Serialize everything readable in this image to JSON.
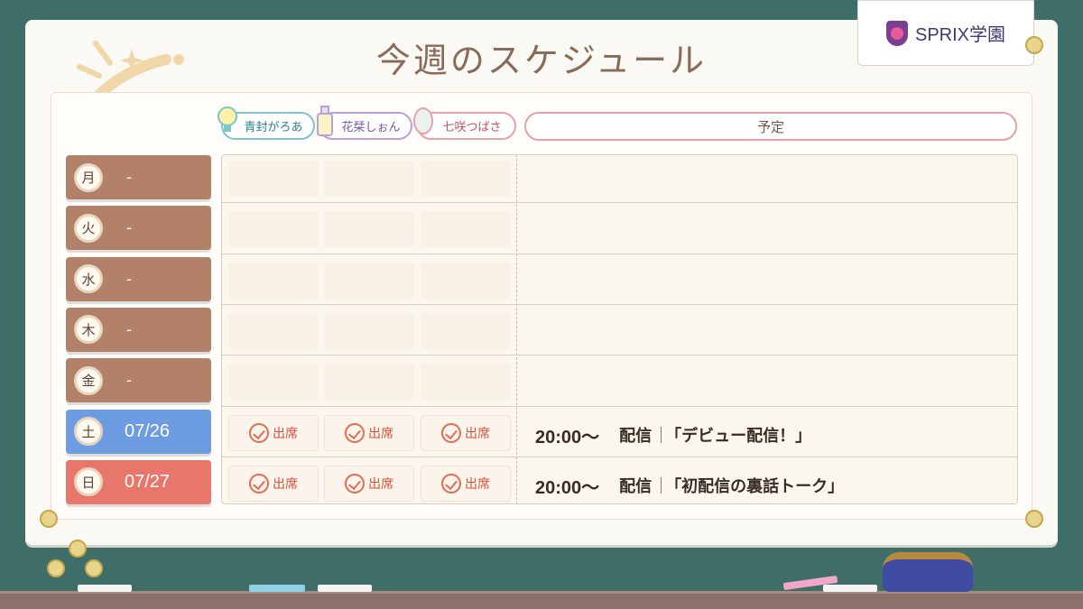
{
  "title": "今週のスケジュール",
  "logo": {
    "text": "SPRIX学園"
  },
  "members": [
    {
      "name": "青封がろあ",
      "color": "#7fc6c9"
    },
    {
      "name": "花栞しぉん",
      "color": "#b8a1d6"
    },
    {
      "name": "七咲つばさ",
      "color": "#e7a2a9"
    }
  ],
  "schedule_header": "予定",
  "attendance_label": "出席",
  "days": [
    {
      "day": "月",
      "date": "-",
      "color": "brown",
      "attendance": [
        false,
        false,
        false
      ],
      "time": "",
      "category": "",
      "title": ""
    },
    {
      "day": "火",
      "date": "-",
      "color": "brown",
      "attendance": [
        false,
        false,
        false
      ],
      "time": "",
      "category": "",
      "title": ""
    },
    {
      "day": "水",
      "date": "-",
      "color": "brown",
      "attendance": [
        false,
        false,
        false
      ],
      "time": "",
      "category": "",
      "title": ""
    },
    {
      "day": "木",
      "date": "-",
      "color": "brown",
      "attendance": [
        false,
        false,
        false
      ],
      "time": "",
      "category": "",
      "title": ""
    },
    {
      "day": "金",
      "date": "-",
      "color": "brown",
      "attendance": [
        false,
        false,
        false
      ],
      "time": "",
      "category": "",
      "title": ""
    },
    {
      "day": "土",
      "date": "07/26",
      "color": "blue",
      "attendance": [
        true,
        true,
        true
      ],
      "time": "20:00～",
      "category": "配信",
      "title": "「デビュー配信！」"
    },
    {
      "day": "日",
      "date": "07/27",
      "color": "red",
      "attendance": [
        true,
        true,
        true
      ],
      "time": "20:00～",
      "category": "配信",
      "title": "「初配信の裏話トーク」"
    }
  ]
}
